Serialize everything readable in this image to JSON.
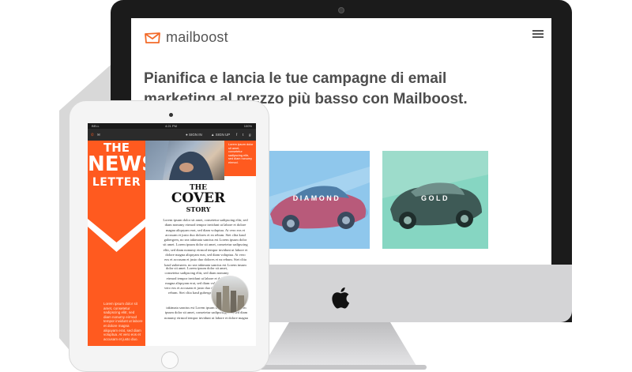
{
  "website": {
    "logo_text": "mailboost",
    "headline": "Pianifica e lancia le tue campagne di email marketing al prezzo più basso con Mailboost.",
    "cards": [
      {
        "label": "DIAMOND",
        "color": "#8fc7ec"
      },
      {
        "label": "GOLD",
        "color": "#86d6c2"
      }
    ],
    "accent_color": "#f26b2a"
  },
  "tablet": {
    "status": {
      "carrier": "BELL",
      "time": "4:21 PM",
      "battery": "100%"
    },
    "nav": {
      "sign_in": "SIGN IN",
      "sign_up": "SIGN UP"
    },
    "newsletter": {
      "title_line1": "THE",
      "title_line2": "NEWS",
      "title_line3": "LETTER",
      "orange_box_text": "Lorem ipsum dolor sit amet, consetetur sadipscing elitr, sed diam nonumy eirmod.",
      "left_text": "Lorem ipsum dolor sit amet, consetetur sadipscing elitr, sed diam nonumy eirmod tempor invidunt ut labore et dolore magna aliquyam erat, sed diam voluptua. At vero eos et accusam et justo duo.",
      "cover_line1": "THE",
      "cover_line2": "COVER",
      "cover_line3": "STORY",
      "body_text": "Lorem ipsum dolor sit amet, consetetur sadipscing elitr, sed diam nonumy eirmod tempor invidunt ut labore et dolore magna aliquyam erat, sed diam voluptua. At vero eos et accusam et justo duo dolores et ea rebum. Stet clita kasd gubergren, no sea takimata sanctus est Lorem ipsum dolor sit amet. Lorem ipsum dolor sit amet, consetetur sadipscing elitr, sed diam nonumy eirmod tempor invidunt ut labore et dolore magna aliquyam erat, sed diam voluptua. At vero eos et accusam et justo duo dolores et ea rebum. Stet clita kasd gubergren, no sea takimata sanctus est Lorem ipsum",
      "body_text2": "dolor sit amet. Lorem ipsum dolor sit amet, consetetur sadipscing elitr, sed diam nonumy eirmod tempor invidunt ut labore et dolore magna aliquyam erat, sed diam voluptua. At vero eos et accusam et justo duo dolores et ea rebum. Stet clita kasd gubergren, no sea",
      "body_text3": "takimata sanctus est Lorem ipsum dolor sit amet. Lorem ipsum dolor sit amet, consetetur sadipscing elitr, sed diam nonumy eirmod tempor invidunt ut labore et dolore magna aliquyam erat, sed diam voluptua."
    }
  }
}
